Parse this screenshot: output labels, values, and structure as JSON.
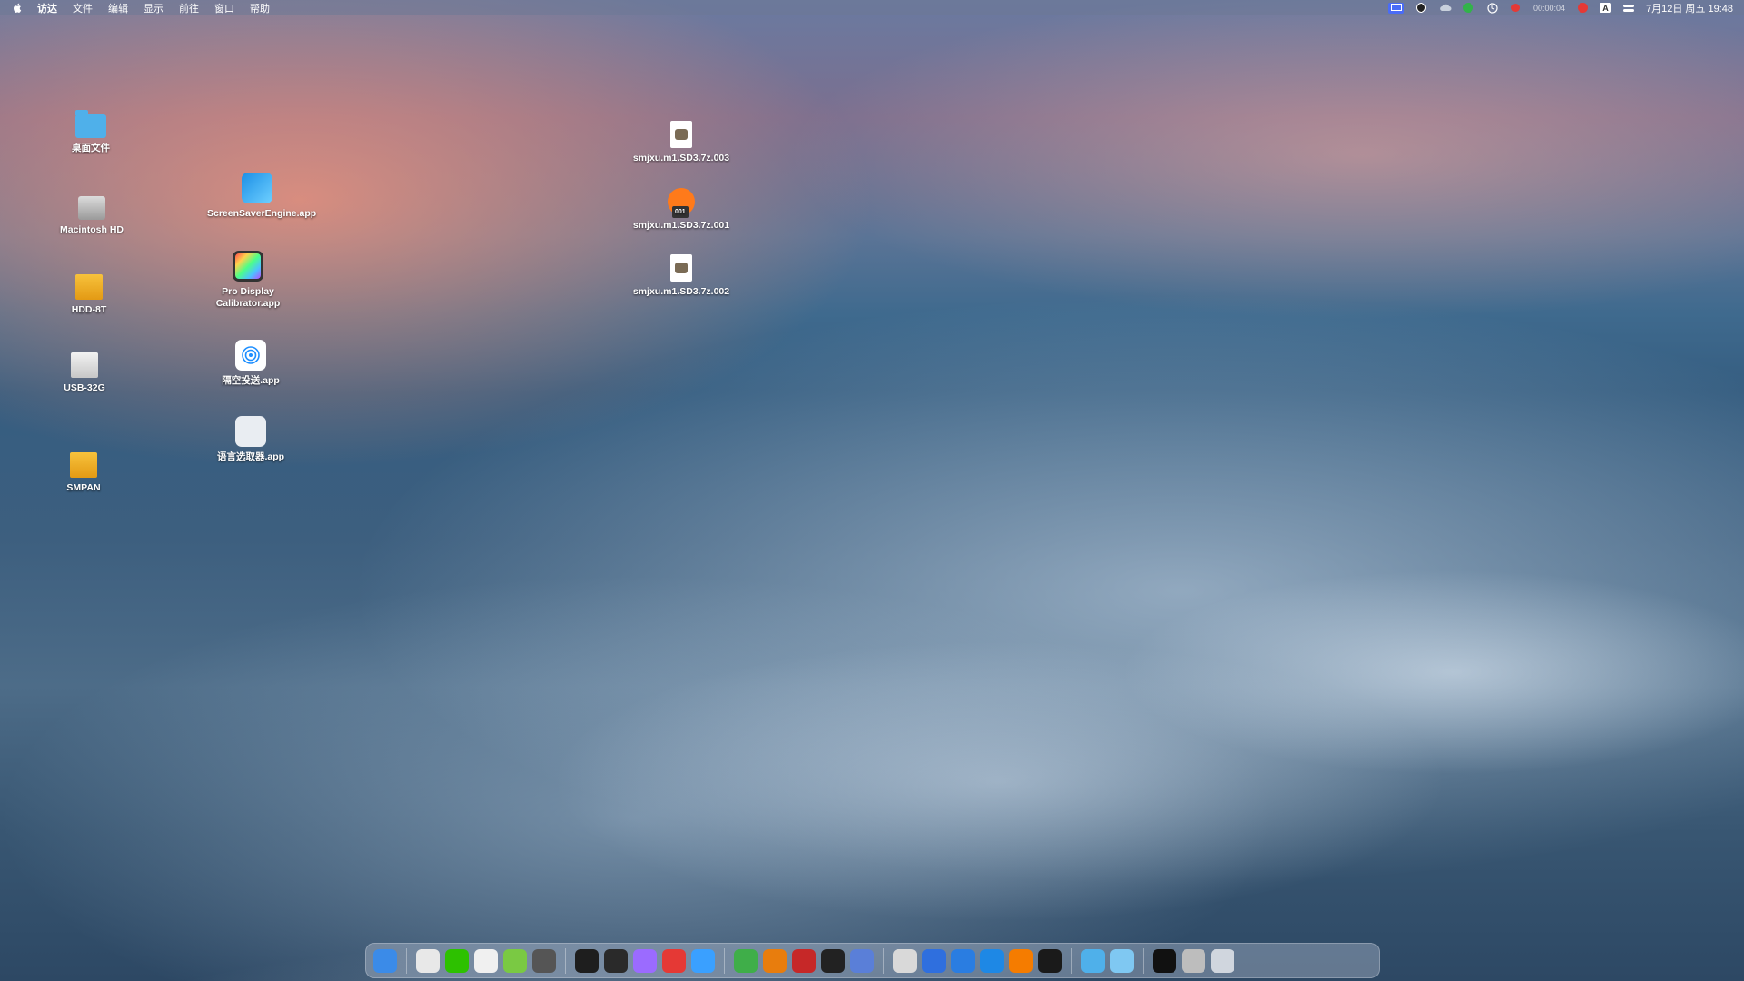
{
  "menubar": {
    "app_name": "访达",
    "menus": [
      "文件",
      "编辑",
      "显示",
      "前往",
      "窗口",
      "帮助"
    ],
    "recording_time": "00:00:04",
    "input_method": "A",
    "datetime": "7月12日 周五 19:48"
  },
  "desktop_icons": [
    {
      "label": "桌面文件",
      "icon": "folder-icon"
    },
    {
      "label": "Macintosh HD",
      "icon": "hard-disk-icon"
    },
    {
      "label": "HDD-8T",
      "icon": "external-disk-icon"
    },
    {
      "label": "USB-32G",
      "icon": "usb-disk-icon"
    },
    {
      "label": "SMPAN",
      "icon": "external-disk-icon"
    },
    {
      "label": "ScreenSaverEngine.app",
      "icon": "screensaver-app-icon"
    },
    {
      "label": "Pro Display Calibrator.app",
      "icon": "calibrator-app-icon"
    },
    {
      "label": "隔空投送.app",
      "icon": "airdrop-app-icon"
    },
    {
      "label": "语言选取器.app",
      "icon": "language-chooser-app-icon"
    },
    {
      "label": "smjxu.m1.SD3.7z.003",
      "icon": "archive-file-icon"
    },
    {
      "label": "smjxu.m1.SD3.7z.001",
      "icon": "archive-001-icon"
    },
    {
      "label": "smjxu.m1.SD3.7z.002",
      "icon": "archive-file-icon"
    }
  ],
  "dock": {
    "apps": [
      {
        "name": "finder",
        "color": "#3b8be8"
      },
      {
        "name": "chrome",
        "color": "#e8e8e8"
      },
      {
        "name": "wechat",
        "color": "#2dc100"
      },
      {
        "name": "qq",
        "color": "#f0f0f0"
      },
      {
        "name": "app-green",
        "color": "#7ac943"
      },
      {
        "name": "app-photo",
        "color": "#555555"
      },
      {
        "name": "terminal",
        "color": "#1e1e1e"
      },
      {
        "name": "activity",
        "color": "#2a2a2a"
      },
      {
        "name": "app-purple",
        "color": "#9b6bff"
      },
      {
        "name": "app-red",
        "color": "#e53935"
      },
      {
        "name": "app-blue",
        "color": "#3aa0ff"
      },
      {
        "name": "app-ot",
        "color": "#3fae49"
      },
      {
        "name": "blender",
        "color": "#e87d0d"
      },
      {
        "name": "app-fs",
        "color": "#c62828"
      },
      {
        "name": "app-dark",
        "color": "#222222"
      },
      {
        "name": "app-send",
        "color": "#5a7fd8"
      },
      {
        "name": "app-rocket",
        "color": "#d9d9d9"
      },
      {
        "name": "app-window",
        "color": "#2f6fde"
      },
      {
        "name": "xcode",
        "color": "#2a7de1"
      },
      {
        "name": "vscode",
        "color": "#1e88e5"
      },
      {
        "name": "sublime",
        "color": "#f57c00"
      },
      {
        "name": "console",
        "color": "#1a1a1a"
      },
      {
        "name": "folder-blue",
        "color": "#4fb0ea"
      },
      {
        "name": "folder-light",
        "color": "#7fc8f2"
      },
      {
        "name": "window-black",
        "color": "#111111"
      },
      {
        "name": "disk-grey",
        "color": "#bdbdbd"
      },
      {
        "name": "trash",
        "color": "#d0d6de"
      }
    ]
  }
}
